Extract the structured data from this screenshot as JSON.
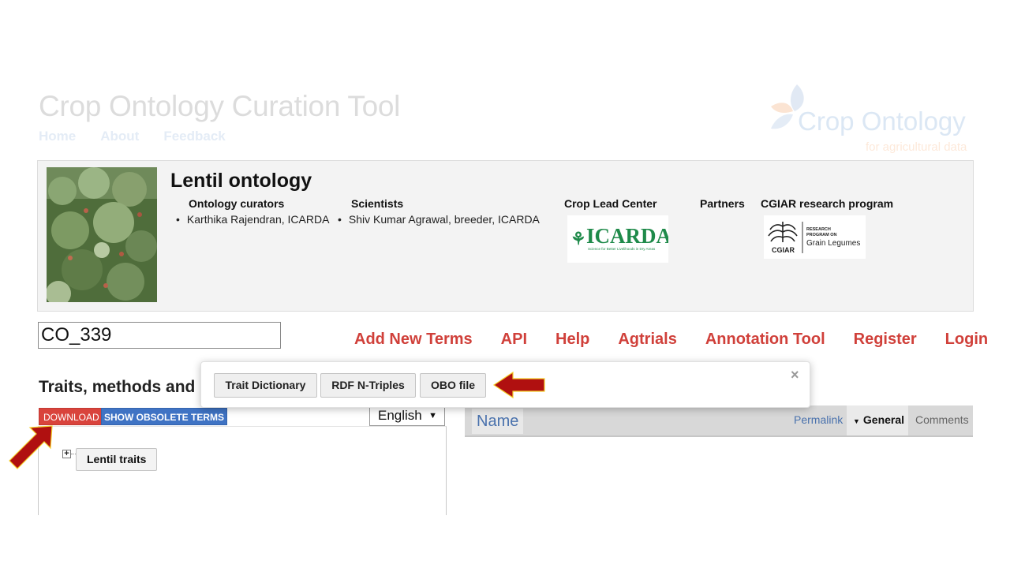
{
  "header": {
    "site_title": "Crop Ontology Curation Tool",
    "nav": [
      "Home",
      "About",
      "Feedback"
    ],
    "brand_name": "Crop Ontology",
    "brand_tagline": "for agricultural data"
  },
  "ontology": {
    "title": "Lentil ontology",
    "curators_heading": "Ontology curators",
    "curators": [
      "Karthika Rajendran, ICARDA"
    ],
    "scientists_heading": "Scientists",
    "scientists": [
      "Shiv Kumar Agrawal, breeder, ICARDA"
    ],
    "lead_center_heading": "Crop Lead Center",
    "partners_heading": "Partners",
    "cgiar_heading": "CGIAR research program",
    "icarda_logo_text": "ICARDA",
    "icarda_logo_tagline": "Science for Better Livelihoods in Dry Areas",
    "cgiar_logo_lines": [
      "RESEARCH",
      "PROGRAM ON",
      "Grain Legumes",
      "CGIAR"
    ]
  },
  "search": {
    "value": "CO_339"
  },
  "main_nav": [
    "Add New Terms",
    "API",
    "Help",
    "Agtrials",
    "Annotation Tool",
    "Register",
    "Login"
  ],
  "section_title": "Traits, methods and s",
  "toolbar": {
    "download_label": "DOWNLOAD",
    "obsolete_label": "SHOW OBSOLETE TERMS",
    "language": "English",
    "language_caret": "▼"
  },
  "tree": {
    "expander": "+",
    "root_label": "Lentil traits"
  },
  "detail": {
    "name_label": "Name",
    "tabs": {
      "permalink": "Permalink",
      "general": "General",
      "comments": "Comments"
    }
  },
  "download_popup": {
    "buttons": [
      "Trait Dictionary",
      "RDF N-Triples",
      "OBO file"
    ],
    "close": "×"
  },
  "colors": {
    "accent_red": "#d0403a",
    "download_red": "#d9433c",
    "obsolete_blue": "#3f73c4",
    "annotation_arrow": "#b01010",
    "link_blue": "#4a72ad"
  },
  "icons": [
    "plant-photo",
    "icarda-logo",
    "cgiar-logo",
    "crop-ontology-logo",
    "tree-expand-icon",
    "close-icon",
    "annotation-arrow"
  ]
}
